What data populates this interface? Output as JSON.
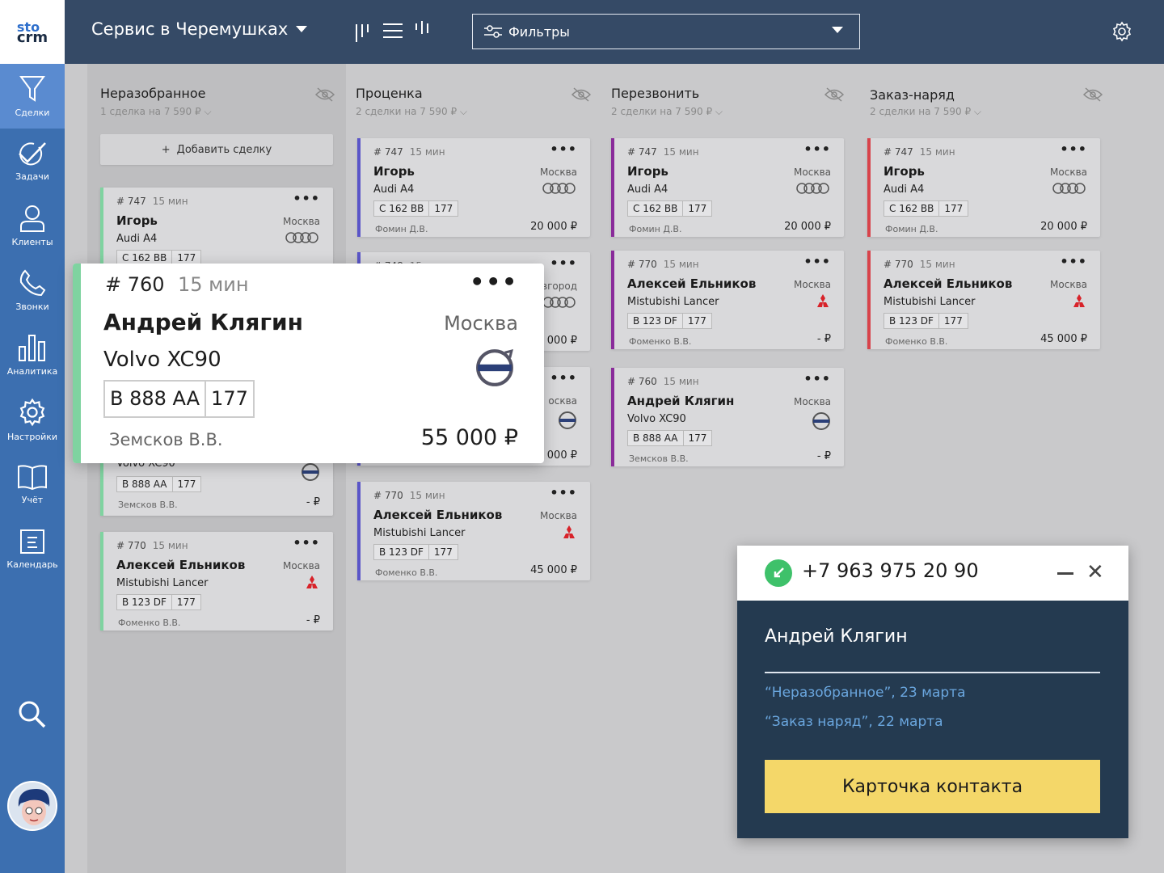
{
  "app": {
    "logo_top": "sto",
    "logo_bottom": "crm"
  },
  "header": {
    "company": "Сервис в Черемушках",
    "filters_label": "Фильтры"
  },
  "sidebar": {
    "items": [
      {
        "label": "Сделки",
        "icon": "funnel-icon"
      },
      {
        "label": "Задачи",
        "icon": "check-icon"
      },
      {
        "label": "Клиенты",
        "icon": "user-icon"
      },
      {
        "label": "Звонки",
        "icon": "phone-icon"
      },
      {
        "label": "Аналитика",
        "icon": "bar-chart-icon"
      },
      {
        "label": "Настройки",
        "icon": "gear-icon"
      },
      {
        "label": "Учёт",
        "icon": "book-icon"
      },
      {
        "label": "Календарь",
        "icon": "calendar-icon"
      }
    ]
  },
  "columns": [
    {
      "title": "Неразобранное",
      "sub": "1 сделка на 7 590 ₽"
    },
    {
      "title": "Проценка",
      "sub": "2 сделки на 7 590 ₽"
    },
    {
      "title": "Перезвонить",
      "sub": "2 сделки на 7 590 ₽"
    },
    {
      "title": "Заказ-наряд",
      "sub": "2 сделки на 7 590 ₽"
    }
  ],
  "add_deal": "Добавить сделку",
  "cards": {
    "c1a": {
      "num": "# 747",
      "time": "15 мин",
      "name": "Игорь",
      "city": "Москва",
      "car": "Audi A4",
      "plate": "C 162 BB",
      "region": "177"
    },
    "c1c": {
      "num": "",
      "car": "Volvo XC90",
      "plate": "B 888 AA",
      "region": "177",
      "mgr": "Земсков В.В.",
      "price": "- ₽"
    },
    "c1d": {
      "num": "# 770",
      "time": "15 мин",
      "name": "Алексей Ельников",
      "city": "Москва",
      "car": "Mistubishi Lancer",
      "plate": "B 123 DF",
      "region": "177",
      "mgr": "Фоменко В.В.",
      "price": "- ₽"
    },
    "c2a": {
      "num": "# 747",
      "time": "15 мин",
      "name": "Игорь",
      "city": "Москва",
      "car": "Audi A4",
      "plate": "C 162 BB",
      "region": "177",
      "mgr": "Фомин Д.В.",
      "price": "20 000 ₽"
    },
    "c2b": {
      "num": "# 748",
      "time": "15 мин",
      "city": "вгород",
      "price": "000 ₽"
    },
    "c2c": {
      "city": "осква",
      "price": "000 ₽"
    },
    "c2d": {
      "num": "# 770",
      "time": "15 мин",
      "name": "Алексей Ельников",
      "city": "Москва",
      "car": "Mistubishi Lancer",
      "plate": "B 123 DF",
      "region": "177",
      "mgr": "Фоменко В.В.",
      "price": "45 000 ₽"
    },
    "c3a": {
      "num": "# 747",
      "time": "15 мин",
      "name": "Игорь",
      "city": "Москва",
      "car": "Audi A4",
      "plate": "C 162 BB",
      "region": "177",
      "mgr": "Фомин Д.В.",
      "price": "20 000 ₽"
    },
    "c3b": {
      "num": "# 770",
      "time": "15 мин",
      "name": "Алексей Ельников",
      "city": "Москва",
      "car": "Mistubishi Lancer",
      "plate": "B 123 DF",
      "region": "177",
      "mgr": "Фоменко В.В.",
      "price": "- ₽"
    },
    "c3c": {
      "num": "# 760",
      "time": "15 мин",
      "name": "Андрей Клягин",
      "city": "Москва",
      "car": "Volvo XC90",
      "plate": "B 888 AA",
      "region": "177",
      "mgr": "Земсков В.В.",
      "price": "- ₽"
    },
    "c4a": {
      "num": "# 747",
      "time": "15 мин",
      "name": "Игорь",
      "city": "Москва",
      "car": "Audi A4",
      "plate": "C 162 BB",
      "region": "177",
      "mgr": "Фомин Д.В.",
      "price": "20 000 ₽"
    },
    "c4b": {
      "num": "# 770",
      "time": "15 мин",
      "name": "Алексей Ельников",
      "city": "Москва",
      "car": "Mistubishi Lancer",
      "plate": "B 123 DF",
      "region": "177",
      "mgr": "Фоменко В.В.",
      "price": "45 000 ₽"
    }
  },
  "dragged_card": {
    "num": "# 760",
    "time": "15 мин",
    "name": "Андрей Клягин",
    "city": "Москва",
    "car": "Volvo XC90",
    "plate": "B 888 AA",
    "region": "177",
    "mgr": "Земсков В.В.",
    "price": "55 000 ₽"
  },
  "call": {
    "number": "+7 963 975 20 90",
    "name": "Андрей Клягин",
    "history": [
      "“Неразобранное”, 23 марта",
      "“Заказ наряд”, 22 марта"
    ],
    "button": "Карточка контакта"
  },
  "colors": {
    "topbar": "#354a66",
    "sidebar": "#3c6fb0",
    "accent_green": "#7fd3a0",
    "accent_blue": "#5a55c8",
    "accent_purple": "#8a2b9a",
    "accent_red": "#d8434b",
    "button_yellow": "#f4d769"
  }
}
